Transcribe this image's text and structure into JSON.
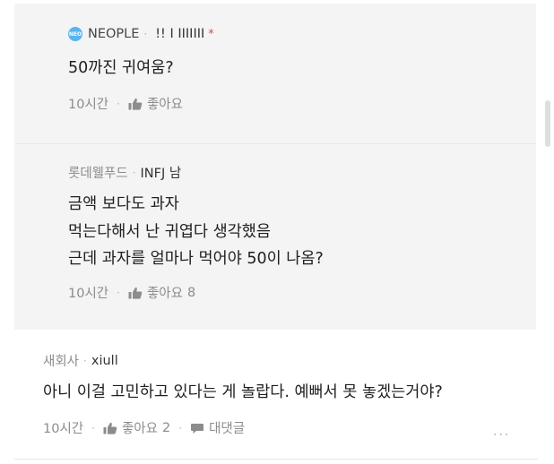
{
  "comments": [
    {
      "badge": "NEO",
      "nickname": "NEOPLE",
      "tag": "!! I IIIIIII",
      "star": "*",
      "text": "50까진 귀여움?",
      "time": "10시간",
      "like_label": "좋아요",
      "like_count": ""
    },
    {
      "nickname": "롯데웰푸드",
      "tag": "INFJ 남",
      "text": "금액 보다도 과자\n먹는다해서 난 귀엽다 생각했음\n근데 과자를 얼마나 먹어야 50이 나옴?",
      "time": "10시간",
      "like_label": "좋아요",
      "like_count": "8"
    },
    {
      "nickname": "새회사",
      "tag": "xiull",
      "text": "아니 이걸 고민하고 있다는 게 놀랍다. 예뻐서 못 놓겠는거야?",
      "time": "10시간",
      "like_label": "좋아요",
      "like_count": "2",
      "reply_label": "대댓글",
      "more": "···"
    }
  ]
}
